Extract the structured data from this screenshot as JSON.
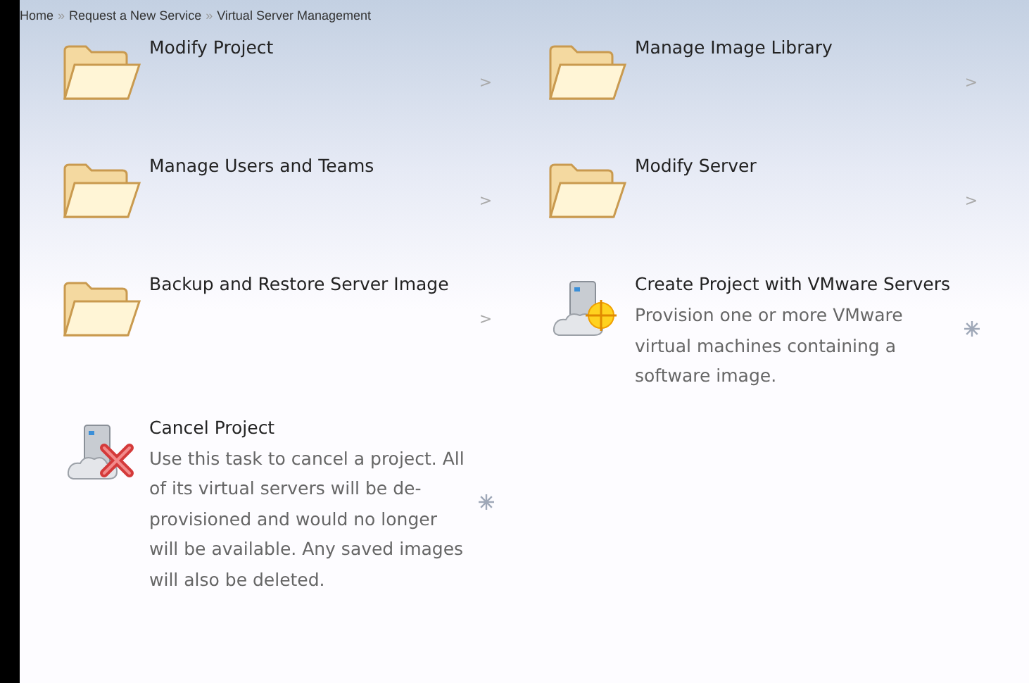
{
  "breadcrumb": [
    {
      "kind": "link",
      "label": "Home"
    },
    {
      "kind": "separator",
      "label": "»"
    },
    {
      "kind": "link",
      "label": "Request a New Service"
    },
    {
      "kind": "separator",
      "label": "»"
    },
    {
      "kind": "current",
      "label": "Virtual Server Management"
    }
  ],
  "items": [
    {
      "kind": "folder",
      "title": "Modify Project",
      "chevron": ">"
    },
    {
      "kind": "folder",
      "title": "Manage Image Library",
      "chevron": ">"
    },
    {
      "kind": "folder",
      "title": "Manage Users and Teams",
      "chevron": ">"
    },
    {
      "kind": "folder",
      "title": "Modify Server",
      "chevron": ">"
    },
    {
      "kind": "folder",
      "title": "Backup and Restore Server Image",
      "chevron": ">"
    },
    {
      "kind": "create",
      "title": "Create Project with VMware Servers",
      "description": "Provision one or more VMware virtual machines containing a software image."
    },
    {
      "kind": "cancel",
      "title": "Cancel Project",
      "description": "Use this task to cancel a project. All of its virtual servers will be de-provisioned and would no longer will be available. Any saved images will also be deleted."
    }
  ]
}
